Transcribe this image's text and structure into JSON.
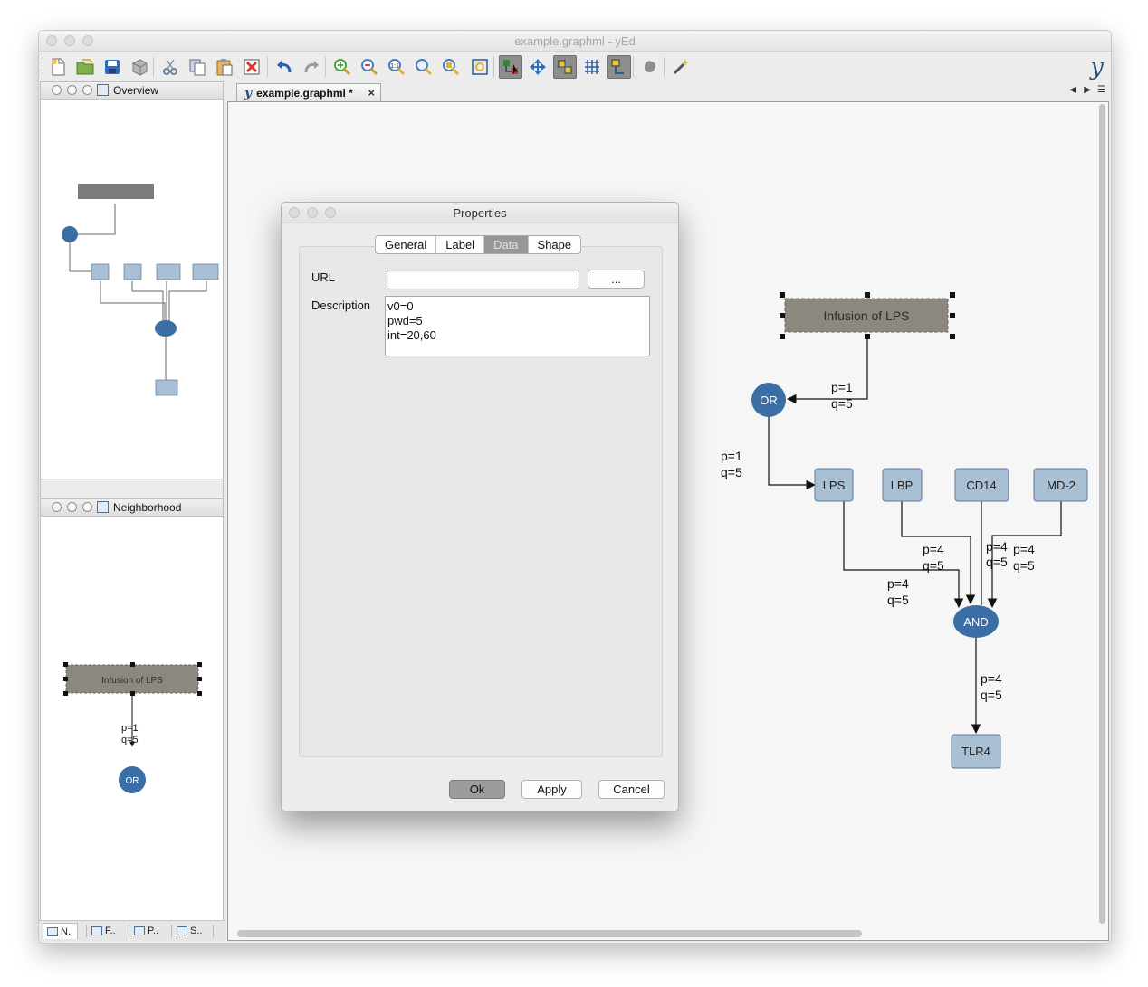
{
  "window": {
    "title": "example.graphml - yEd"
  },
  "toolbar": {
    "buttons": [
      {
        "name": "new-document-icon",
        "color": "#f0c24b"
      },
      {
        "name": "open-folder-icon",
        "color": "#7fb04a"
      },
      {
        "name": "save-icon",
        "color": "#2e6cc4"
      },
      {
        "name": "properties-icon",
        "color": "#b8b8b8"
      },
      {
        "name": "cut-icon",
        "color": "#6b7fa3"
      },
      {
        "name": "copy-icon",
        "color": "#cfd6e3"
      },
      {
        "name": "paste-icon",
        "color": "#e7b860"
      },
      {
        "name": "delete-icon",
        "color": "#d93a2b"
      },
      {
        "name": "undo-icon",
        "color": "#2b62b0"
      },
      {
        "name": "redo-icon",
        "color": "#9a9a9a"
      },
      {
        "name": "zoom-in-icon",
        "color": "#4aa53c"
      },
      {
        "name": "zoom-out-icon",
        "color": "#d6463a"
      },
      {
        "name": "zoom-original-icon",
        "color": "#d8b23a"
      },
      {
        "name": "zoom-area-icon",
        "color": "#d8b23a"
      },
      {
        "name": "zoom-selection-icon",
        "color": "#d8b23a"
      },
      {
        "name": "fit-content-icon",
        "color": "#d8b23a"
      },
      {
        "name": "edit-mode-icon",
        "color": "#3a7f3a",
        "pressed": true
      },
      {
        "name": "navigation-mode-icon",
        "color": "#2b70c2"
      },
      {
        "name": "snap-lines-icon",
        "color": "#e8c837",
        "pressed": true
      },
      {
        "name": "grid-icon",
        "color": "#2c5a9c"
      },
      {
        "name": "orthogonal-edges-icon",
        "color": "#e8c837",
        "pressed": true
      },
      {
        "name": "group-icon",
        "color": "#8f8f8f"
      },
      {
        "name": "magic-wand-icon",
        "color": "#d8b23a"
      }
    ]
  },
  "overview_panel": {
    "title": "Overview"
  },
  "neighborhood_panel": {
    "title": "Neighborhood",
    "node_label": "Infusion of LPS",
    "edge_label_p": "p=1",
    "edge_label_q": "q=5",
    "target_label": "OR"
  },
  "bottom_tabs": [
    "N..",
    "F..",
    "P..",
    "S.."
  ],
  "document_tab": {
    "label": "example.graphml *"
  },
  "dialog": {
    "title": "Properties",
    "tabs": [
      "General",
      "Label",
      "Data",
      "Shape"
    ],
    "active_tab": "Data",
    "url_label": "URL",
    "url_value": "",
    "browse_label": "...",
    "description_label": "Description",
    "description_value": "v0=0\npwd=5\nint=20,60",
    "ok_label": "Ok",
    "apply_label": "Apply",
    "cancel_label": "Cancel"
  },
  "graph": {
    "colors": {
      "box_node": "#a9bfd4",
      "circle_node": "#3b6ea5",
      "top_node": "#8c8880"
    },
    "nodes": {
      "infusion": "Infusion of LPS",
      "or": "OR",
      "lps": "LPS",
      "lbp": "LBP",
      "cd14": "CD14",
      "md2": "MD-2",
      "and": "AND",
      "tlr4": "TLR4"
    },
    "edge_labels": {
      "infusion_or": [
        "p=1",
        "q=5"
      ],
      "or_lps": [
        "p=1",
        "q=5"
      ],
      "lps_and": [
        "p=4",
        "q=5"
      ],
      "lbp_and": [
        "p=4",
        "q=5"
      ],
      "cd14_and": [
        "p=4",
        "q=5"
      ],
      "md2_and": [
        "p=4",
        "q=5"
      ],
      "and_tlr4": [
        "p=4",
        "q=5"
      ]
    }
  }
}
